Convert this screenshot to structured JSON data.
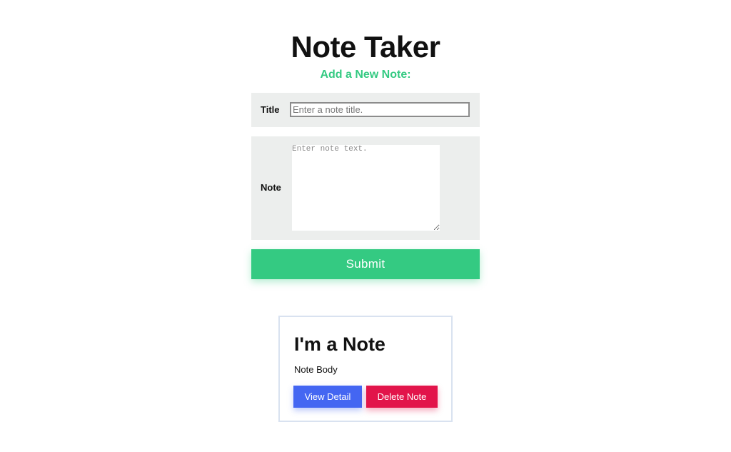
{
  "app": {
    "title": "Note Taker",
    "subtitle": "Add a New Note:"
  },
  "form": {
    "title_label": "Title",
    "title_placeholder": "Enter a note title.",
    "title_value": "",
    "note_label": "Note",
    "note_placeholder": "Enter note text.",
    "note_value": "",
    "submit_label": "Submit"
  },
  "notes": [
    {
      "title": "I'm a Note",
      "body": "Note Body",
      "view_label": "View Detail",
      "delete_label": "Delete Note"
    }
  ],
  "colors": {
    "accent_green": "#34ca82",
    "view_blue": "#4466f2",
    "delete_red": "#e2144a",
    "form_bg": "#eceeed",
    "card_border": "#d9e2f0"
  }
}
